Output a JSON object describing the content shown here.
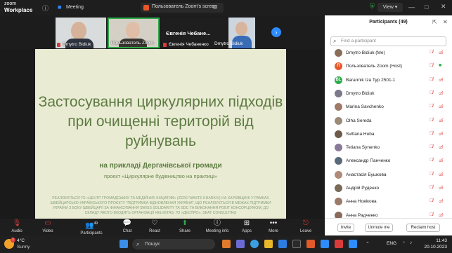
{
  "app": {
    "logo_top": "zoom",
    "logo_bottom": "Workplace",
    "meeting_tab": "Meeting",
    "screen_tab": "Пользователь Zoom's screen",
    "view_label": "View"
  },
  "video_strip": {
    "tiles": [
      {
        "name": "Dmytro Bidiuk"
      },
      {
        "name": "Пользователь Zoom"
      },
      {
        "name": "Євгенія Чебане...",
        "sub": "Євгенія Чебаненко"
      },
      {
        "name": "Dmytro Bidiuk"
      }
    ]
  },
  "slide": {
    "title": "Застосування циркулярних підходів при очищенні територій від руйнувань",
    "subtitle": "на прикладі Дергачівської громади",
    "project": "проєкт «Циркулярне будівництво на практиці»",
    "footer": "РЕАЛІЗУЄТЬСЯ ГО «ЦЕНТР ГРОМАДСЬКИХ ТА МЕДІЙНИХ ІНІЦІАТИВ» (ZERO WASTE KHARKIV) НА ХАРКІВЩИНІ У РАМКАХ ШВЕЙЦАРСЬКО-УКРАЇНСЬКОГО ПРОЄКТУ \"ПІДТРИМКА ВІДНОВЛЕННЯ УКРАЇНИ\", ЩО РЕАЛІЗУЄТЬСЯ В МЕЖАХ ПІДТРИМКИ УКРАЇНИ З БОКУ ШВЕЙЦАРІЇ ЗА ФІНАНСУВАННЯ SWISS SOLIDARITY ТА SDC ТА ВИКОНАННЯ РОБІТ КОНСОРЦІУМОМ, ДО СКЛАДУ ЯКОГО ВХОДЯТЬ ОРГАНІЗАЦІЇ HELVETAS, ГО «ДЕСПРО», SKAT CONSULTING"
  },
  "toolbar": {
    "audio": "Audio",
    "video": "Video",
    "participants": "Participants",
    "participants_count": "49",
    "chat": "Chat",
    "react": "React",
    "share": "Share",
    "meeting_info": "Meeting info",
    "apps": "Apps",
    "more": "More",
    "leave": "Leave"
  },
  "panel": {
    "title": "Participants (49)",
    "search_placeholder": "Find a participant",
    "participants": [
      {
        "name": "Dmytro Bidiuk (Me)",
        "avatar": "",
        "color": "#8a6e5a"
      },
      {
        "name": "Пользователь Zoom (Host)",
        "avatar": "П",
        "color": "#e8572a"
      },
      {
        "name": "Barannik Iza Typ 2501-1",
        "avatar": "BL",
        "color": "#2eaa4a"
      },
      {
        "name": "Dmytro Bidiuk",
        "avatar": "",
        "color": "#7a7a8a"
      },
      {
        "name": "Marina Savchenko",
        "avatar": "",
        "color": "#a07a68"
      },
      {
        "name": "Olha Sereda",
        "avatar": "",
        "color": "#9a8a78"
      },
      {
        "name": "Svitlana Huba",
        "avatar": "",
        "color": "#6e5a4a"
      },
      {
        "name": "Tetiana Synenko",
        "avatar": "",
        "color": "#8a7a9a"
      },
      {
        "name": "Александр Панченко",
        "avatar": "",
        "color": "#5a6a7a"
      },
      {
        "name": "Анастасія Бушкова",
        "avatar": "",
        "color": "#b08a78"
      },
      {
        "name": "Андрій Руденко",
        "avatar": "",
        "color": "#7a6a5a"
      },
      {
        "name": "Анна Новікова",
        "avatar": "",
        "color": "#9a7a6a"
      },
      {
        "name": "Анна Радченко",
        "avatar": "",
        "color": "#8a6a5a"
      }
    ],
    "invite": "Invite",
    "unmute_me": "Unmute me",
    "reclaim_host": "Reclaim host"
  },
  "taskbar": {
    "temp": "4°C",
    "weather": "Sunny",
    "search": "Пошук",
    "lang": "ENG",
    "time": "11:43",
    "date": "20.10.2023",
    "badge": "1"
  }
}
